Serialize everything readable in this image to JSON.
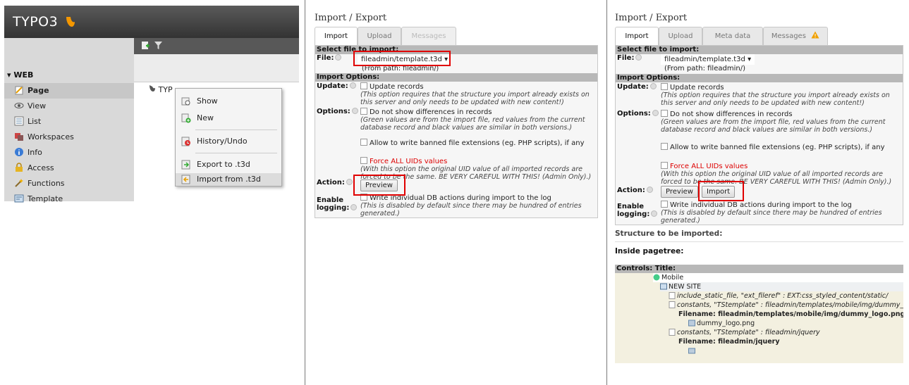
{
  "backend": {
    "logo_text": "TYPO3",
    "section_label": "▾ WEB",
    "modules": [
      {
        "label": "Page",
        "icon": "page-icon",
        "active": true
      },
      {
        "label": "View",
        "icon": "eye-icon"
      },
      {
        "label": "List",
        "icon": "list-icon"
      },
      {
        "label": "Workspaces",
        "icon": "workspaces-icon"
      },
      {
        "label": "Info",
        "icon": "info-icon"
      },
      {
        "label": "Access",
        "icon": "lock-icon"
      },
      {
        "label": "Functions",
        "icon": "wand-icon"
      },
      {
        "label": "Template",
        "icon": "template-icon"
      }
    ],
    "tree_item": "TYP",
    "context_menu": [
      {
        "label": "Show",
        "icon": "show-icon"
      },
      {
        "label": "New",
        "icon": "new-icon"
      },
      {
        "label": "History/Undo",
        "icon": "history-icon"
      },
      {
        "label": "Export to .t3d",
        "icon": "export-icon"
      },
      {
        "label": "Import from .t3d",
        "icon": "import-icon",
        "highlighted": true
      }
    ]
  },
  "ie": {
    "title": "Import / Export",
    "tabs_panel2": [
      "Import",
      "Upload",
      "Messages"
    ],
    "tabs_panel3": [
      "Import",
      "Upload",
      "Meta data",
      "Messages"
    ],
    "select_file_header": "Select file to import:",
    "file_label": "File:",
    "file_value": "fileadmin/template.t3d",
    "from_path": "(From path: fileadmin/)",
    "import_options_header": "Import Options:",
    "update_label": "Update:",
    "update_option": "Update records",
    "update_hint": "(This option requires that the structure you import already exists on this server and only needs to be updated with new content!)",
    "options_label": "Options:",
    "no_diff_option": "Do not show differences in records",
    "no_diff_hint": "(Green values are from the import file, red values from the current database record and black values are similar in both versions.)",
    "banned_ext_option": "Allow to write banned file extensions (eg. PHP scripts), if any",
    "force_uids_option": "Force ALL UIDs values",
    "force_uids_hint": "(With this option the original UID value of all imported records are forced to be the same. BE VERY CAREFUL WITH THIS! (Admin Only).)",
    "action_label": "Action:",
    "preview_button": "Preview",
    "import_button": "Import",
    "enable_logging_label_1": "Enable",
    "enable_logging_label_2": "logging:",
    "logging_option": "Write individual DB actions during import to the log",
    "logging_hint": "(This is disabled by default since there may be hundred of entries generated.)",
    "structure_heading": "Structure to be imported:",
    "inside_pagetree": "Inside pagetree:",
    "controls_header": "Controls: Title:"
  },
  "tree": {
    "rows": [
      {
        "text": "Mobile"
      },
      {
        "text": "NEW SITE"
      },
      {
        "text": "include_static_file, \"ext_fileref\" : EXT:css_styled_content/static/"
      },
      {
        "text": "constants, \"TStemplate\" : fileadmin/templates/mobile/img/dummy_lo"
      },
      {
        "text": "Filename: fileadmin/templates/mobile/img/dummy_logo.png"
      },
      {
        "text": "dummy_logo.png"
      },
      {
        "text": "constants, \"TStemplate\" : fileadmin/jquery"
      },
      {
        "text": "Filename: fileadmin/jquery"
      }
    ]
  },
  "colors": {
    "highlight_box": "#e00000",
    "warning": "#f0a000",
    "tree_bg": "#f3f0e0"
  }
}
